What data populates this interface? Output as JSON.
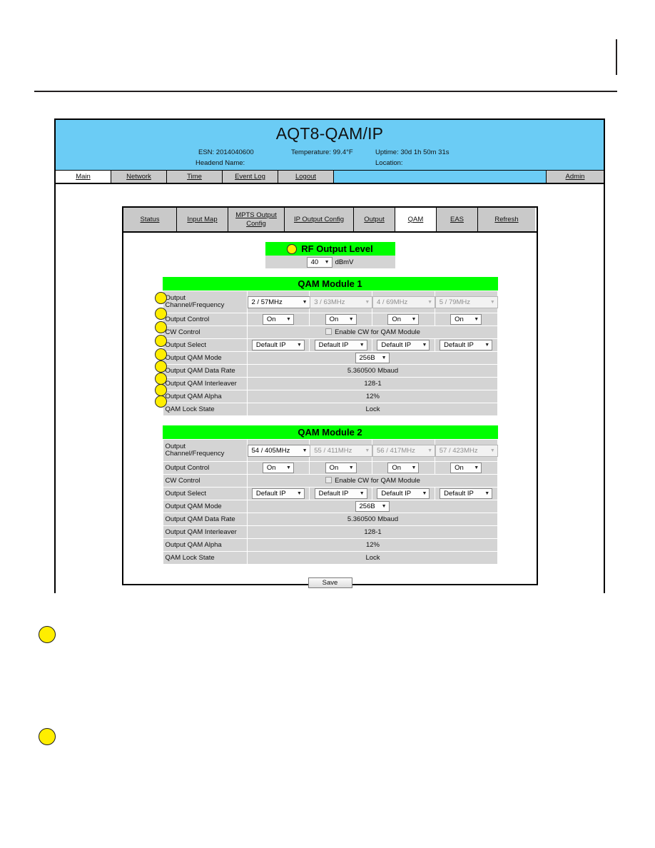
{
  "unit": {
    "title": "AQT8-QAM/IP",
    "esn": "ESN: 2014040600",
    "temperature": "Temperature: 99.4°F",
    "uptime": "Uptime: 30d 1h 50m 31s",
    "headend_name": "Headend Name:",
    "location": "Location:"
  },
  "topnav": {
    "items": [
      {
        "label": "Main",
        "active": true
      },
      {
        "label": "Network",
        "active": false
      },
      {
        "label": "Time",
        "active": false
      },
      {
        "label": "Event Log",
        "active": false
      },
      {
        "label": "Logout",
        "active": false
      }
    ],
    "admin": "Admin"
  },
  "subtabs": [
    {
      "label": "Status"
    },
    {
      "label": "Input Map"
    },
    {
      "label_line1": "MPTS Output",
      "label_line2": "Config"
    },
    {
      "label": "IP Output Config"
    },
    {
      "label": "Output"
    },
    {
      "label": "QAM",
      "active": true
    },
    {
      "label": "EAS"
    },
    {
      "label": "Refresh"
    }
  ],
  "rf_output_level": {
    "heading": "RF Output Level",
    "value": "40",
    "unit": "dBmV",
    "arrow": "▼"
  },
  "labels": {
    "output_channel_frequency_l1": "Output",
    "output_channel_frequency_l2": "Channel/Frequency",
    "output_control": "Output Control",
    "cw_control": "CW Control",
    "cw_checkbox_label": "Enable CW for QAM Module",
    "output_select": "Output Select",
    "output_qam_mode": "Output QAM Mode",
    "output_qam_data_rate": "Output QAM Data Rate",
    "output_qam_interleaver": "Output QAM Interleaver",
    "output_qam_alpha": "Output QAM Alpha",
    "qam_lock_state": "QAM Lock State"
  },
  "module1": {
    "heading": "QAM Module 1",
    "channels": [
      {
        "freq": "2 / 57MHz",
        "enabled": true
      },
      {
        "freq": "3 / 63MHz",
        "enabled": false
      },
      {
        "freq": "4 / 69MHz",
        "enabled": false
      },
      {
        "freq": "5 / 79MHz",
        "enabled": false
      }
    ],
    "output_control": [
      "On",
      "On",
      "On",
      "On"
    ],
    "output_select": [
      "Default IP",
      "Default IP",
      "Default IP",
      "Default IP"
    ],
    "qam_mode": "256B",
    "data_rate": "5.360500 Mbaud",
    "interleaver": "128-1",
    "alpha": "12%",
    "lock_state": "Lock"
  },
  "module2": {
    "heading": "QAM Module 2",
    "channels": [
      {
        "freq": "54 / 405MHz",
        "enabled": true
      },
      {
        "freq": "55 / 411MHz",
        "enabled": false
      },
      {
        "freq": "56 / 417MHz",
        "enabled": false
      },
      {
        "freq": "57 / 423MHz",
        "enabled": false
      }
    ],
    "output_control": [
      "On",
      "On",
      "On",
      "On"
    ],
    "output_select": [
      "Default IP",
      "Default IP",
      "Default IP",
      "Default IP"
    ],
    "qam_mode": "256B",
    "data_rate": "5.360500 Mbaud",
    "interleaver": "128-1",
    "alpha": "12%",
    "lock_state": "Lock"
  },
  "save": {
    "label": "Save"
  },
  "colors": {
    "header_blue": "#6bccf5",
    "section_green": "#00ff00",
    "row_gray": "#d4d4d4",
    "tab_gray": "#c9c9c9",
    "callout_yellow": "#ffee00"
  },
  "glyphs": {
    "arrow_down": "▼"
  }
}
